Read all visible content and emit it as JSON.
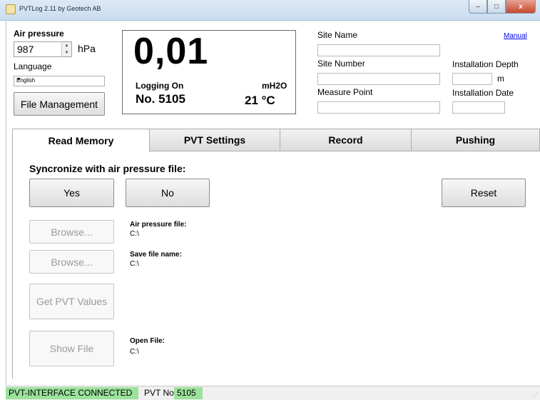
{
  "window": {
    "title": "PVTLog 2.11 by Geotech AB",
    "min_glyph": "–",
    "max_glyph": "□",
    "close_glyph": "x"
  },
  "top": {
    "air_pressure_label": "Air pressure",
    "air_pressure_value": "987",
    "air_pressure_unit": "hPa",
    "language_label": "Language",
    "language_value": "English",
    "file_management_label": "File Management"
  },
  "display": {
    "value": "0,01",
    "logging_status": "Logging On",
    "unit": "mH2O",
    "number": "No.  5105",
    "temperature": "21   °C"
  },
  "site": {
    "site_name_label": "Site Name",
    "site_name_value": "",
    "site_number_label": "Site Number",
    "site_number_value": "",
    "measure_point_label": "Measure Point",
    "measure_point_value": "",
    "manual_link": "Manual",
    "installation_depth_label": "Installation Depth",
    "installation_depth_value": "",
    "installation_depth_unit": "m",
    "installation_date_label": "Installation Date",
    "installation_date_value": ""
  },
  "tabs": [
    {
      "label": "Read Memory",
      "active": true
    },
    {
      "label": "PVT Settings",
      "active": false
    },
    {
      "label": "Record",
      "active": false
    },
    {
      "label": "Pushing",
      "active": false
    }
  ],
  "read_memory": {
    "sync_question": "Syncronize with air pressure file:",
    "yes_label": "Yes",
    "no_label": "No",
    "reset_label": "Reset",
    "browse1_label": "Browse...",
    "browse2_label": "Browse...",
    "get_pvt_values_label": "Get PVT Values",
    "show_file_label": "Show File",
    "air_pressure_file_label": "Air pressure file:",
    "air_pressure_file_value": "C:\\",
    "save_file_name_label": "Save file name:",
    "save_file_name_value": "C:\\",
    "open_file_label": "Open File:",
    "open_file_value": "C:\\"
  },
  "status": {
    "connection": "PVT-INTERFACE CONNECTED",
    "pvt_no_label": "PVT No.",
    "pvt_no_value": "5105"
  },
  "colors": {
    "status_green": "#9be29b",
    "link_blue": "#0000ee"
  }
}
